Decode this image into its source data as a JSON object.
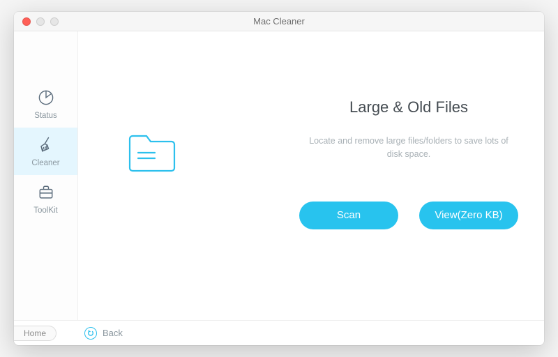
{
  "window": {
    "title": "Mac Cleaner"
  },
  "sidebar": {
    "items": [
      {
        "label": "Status"
      },
      {
        "label": "Cleaner"
      },
      {
        "label": "ToolKit"
      }
    ]
  },
  "main": {
    "heading": "Large & Old Files",
    "subtext": "Locate and remove large files/folders to save lots of disk space.",
    "scan_label": "Scan",
    "view_label": "View(Zero KB)"
  },
  "footer": {
    "home_label": "Home",
    "back_label": "Back"
  },
  "colors": {
    "accent": "#28c3ee"
  },
  "icons": {
    "status": "pie-chart-icon",
    "cleaner": "broom-icon",
    "toolkit": "briefcase-icon",
    "large_old": "folder-icon",
    "back": "undo-icon"
  }
}
